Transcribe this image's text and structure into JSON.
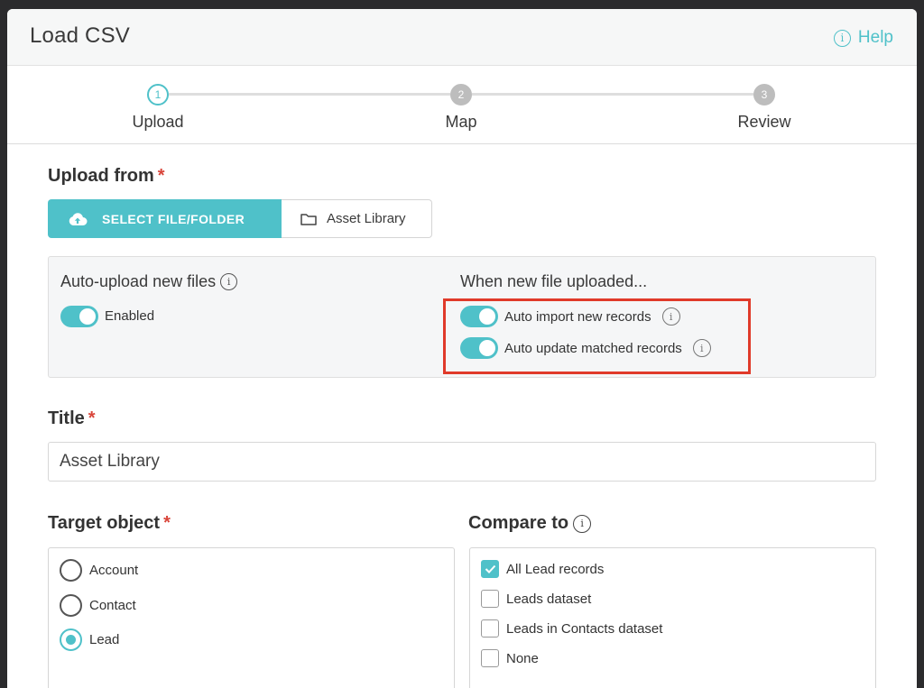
{
  "dialog": {
    "title": "Load CSV",
    "help_label": "Help"
  },
  "stepper": {
    "steps": [
      {
        "number": "1",
        "label": "Upload",
        "state": "active"
      },
      {
        "number": "2",
        "label": "Map",
        "state": "inactive"
      },
      {
        "number": "3",
        "label": "Review",
        "state": "inactive"
      }
    ]
  },
  "upload_from": {
    "label": "Upload from",
    "required_mark": "*",
    "select_button": "SELECT FILE/FOLDER",
    "asset_button": "Asset Library"
  },
  "auto_upload": {
    "heading": "Auto-upload new files",
    "toggle_label": "Enabled",
    "toggle_on": true
  },
  "when_new_file": {
    "heading": "When new file uploaded...",
    "options": [
      {
        "label": "Auto import new records",
        "on": true
      },
      {
        "label": "Auto update matched records",
        "on": true
      }
    ]
  },
  "title_field": {
    "label": "Title",
    "required_mark": "*",
    "value": "Asset Library"
  },
  "target_object": {
    "label": "Target object",
    "required_mark": "*",
    "options": [
      "Account",
      "Contact",
      "Lead"
    ],
    "selected": "Lead"
  },
  "compare_to": {
    "label": "Compare to",
    "options": [
      {
        "label": "All Lead records",
        "checked": true
      },
      {
        "label": "Leads dataset",
        "checked": false
      },
      {
        "label": "Leads in Contacts dataset",
        "checked": false
      },
      {
        "label": "None",
        "checked": false
      }
    ]
  },
  "colors": {
    "accent": "#4fc1c9",
    "required": "#d9453a",
    "highlight": "#e03a2a"
  },
  "icons": {
    "info": "info-icon",
    "upload": "cloud-upload-icon",
    "folder": "folder-icon",
    "checkmark": "checkmark-icon"
  }
}
